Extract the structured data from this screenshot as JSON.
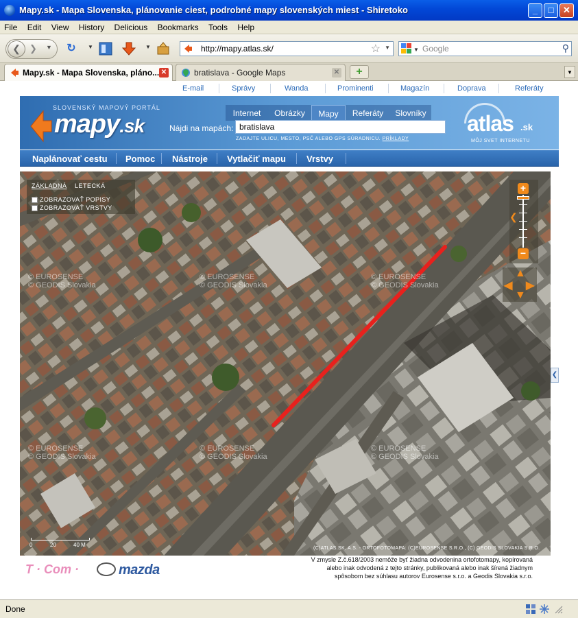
{
  "window": {
    "title": "Mapy.sk - Mapa Slovenska, plánovanie ciest, podrobné mapy slovenských miest - Shiretoko",
    "controls": {
      "minimize": "_",
      "maximize": "□",
      "close": "✕"
    }
  },
  "menu": [
    "File",
    "Edit",
    "View",
    "History",
    "Delicious",
    "Bookmarks",
    "Tools",
    "Help"
  ],
  "toolbar": {
    "url": "http://mapy.atlas.sk/",
    "search_placeholder": "Google"
  },
  "tabs": [
    {
      "label": "Mapy.sk - Mapa Slovenska, pláno...",
      "active": true
    },
    {
      "label": "bratislava - Google Maps",
      "active": false
    }
  ],
  "site": {
    "top_links": [
      "E-mail",
      "Správy",
      "Wanda",
      "Prominenti",
      "Magazín",
      "Doprava",
      "Referáty"
    ],
    "logo_tagline": "SLOVENSKÝ MAPOVÝ PORTÁL",
    "logo_text": "mapy",
    "logo_tld": ".sk",
    "search_tabs": [
      "Internet",
      "Obrázky",
      "Mapy",
      "Referáty",
      "Slovníky"
    ],
    "active_search_tab": "Mapy",
    "search_label": "Nájdi na mapách:",
    "search_value": "bratislava",
    "search_hint": "ZADAJTE ULICU, MESTO, PSČ ALEBO GPS SÚRADNICU.",
    "search_hint_link": "PRÍKLADY",
    "partner_logo": "atlas",
    "partner_tld": ".sk",
    "partner_motto": "MÔJ SVET INTERNETU",
    "main_nav": [
      "Naplánovať cestu",
      "Pomoc",
      "Nástroje",
      "Vytlačiť mapu",
      "Vrstvy"
    ]
  },
  "map": {
    "type_options": [
      "ZÁKLADNÁ",
      "LETECKÁ"
    ],
    "active_type": "ZÁKLADNÁ",
    "checkboxes": [
      "ZOBRAZOVAŤ POPISY",
      "ZOBRAZOVAŤ VRSTVY"
    ],
    "watermark_line1": "© EUROSENSE",
    "watermark_line2": "© GEODIS Slovakia",
    "scale_labels": [
      "0",
      "20",
      "40 M"
    ],
    "copyright": "(C)ATLAS.SK, A.S. - ORTOFOTOMAPA: (C)EUROSENSE S.R.O., (C) GEODIS SLOVAKIA S.R.O.",
    "route_color": "#e8211d"
  },
  "footer": {
    "sponsor1": "T · Com ·",
    "sponsor2": "mazda",
    "legal_lines": [
      "V zmysle Z.č.618/2003 nemôže byť žiadna odvodenina ortofotomapy, kopírovaná",
      "alebo inak odvodená z tejto stránky, publikovaná alebo inak šírená žiadnym",
      "spôsobom bez súhlasu autorov Eurosense s.r.o. a Geodis Slovakia s.r.o."
    ]
  },
  "status": {
    "text": "Done"
  }
}
